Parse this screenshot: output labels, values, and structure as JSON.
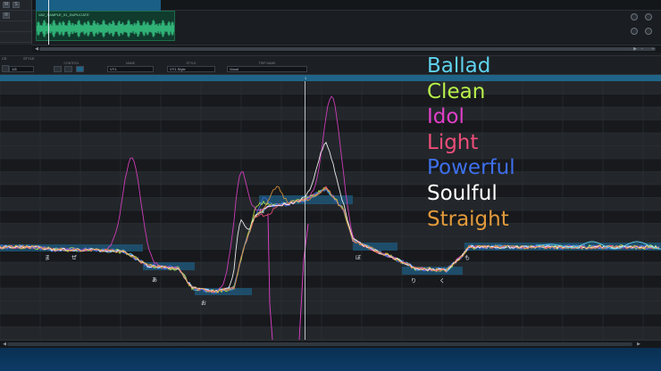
{
  "track": {
    "clip_label": "VA2_SAMPLE_01_DUPLICATE",
    "header_buttons": [
      "M",
      "S",
      "R"
    ]
  },
  "toolbar": {
    "tab_left_1": "CE",
    "tab_left_2": "STYLE",
    "groups": [
      {
        "label": "CONTROL",
        "value": ""
      },
      {
        "label": "NAME",
        "value": "VY1"
      },
      {
        "label": "STYLE",
        "value": "VY1 Style"
      },
      {
        "label": "TRIP NAME",
        "value": "Vocal"
      }
    ],
    "edit_value": "1/8"
  },
  "legend": {
    "items": [
      {
        "label": "Ballad",
        "color": "#5fd3f0"
      },
      {
        "label": "Clean",
        "color": "#b7f04a"
      },
      {
        "label": "Idol",
        "color": "#e23fc9"
      },
      {
        "label": "Light",
        "color": "#ef4d79"
      },
      {
        "label": "Powerful",
        "color": "#3e6fea"
      },
      {
        "label": "Soulful",
        "color": "#ffffff"
      },
      {
        "label": "Straight",
        "color": "#e39a3b"
      }
    ]
  },
  "notes": [
    {
      "lyric": "ま"
    },
    {
      "lyric": "ぜ"
    },
    {
      "lyric": "あ"
    },
    {
      "lyric": "お"
    },
    {
      "lyric": "ね"
    },
    {
      "lyric": "ぼ"
    },
    {
      "lyric": "り"
    },
    {
      "lyric": "く"
    },
    {
      "lyric": "も"
    }
  ]
}
